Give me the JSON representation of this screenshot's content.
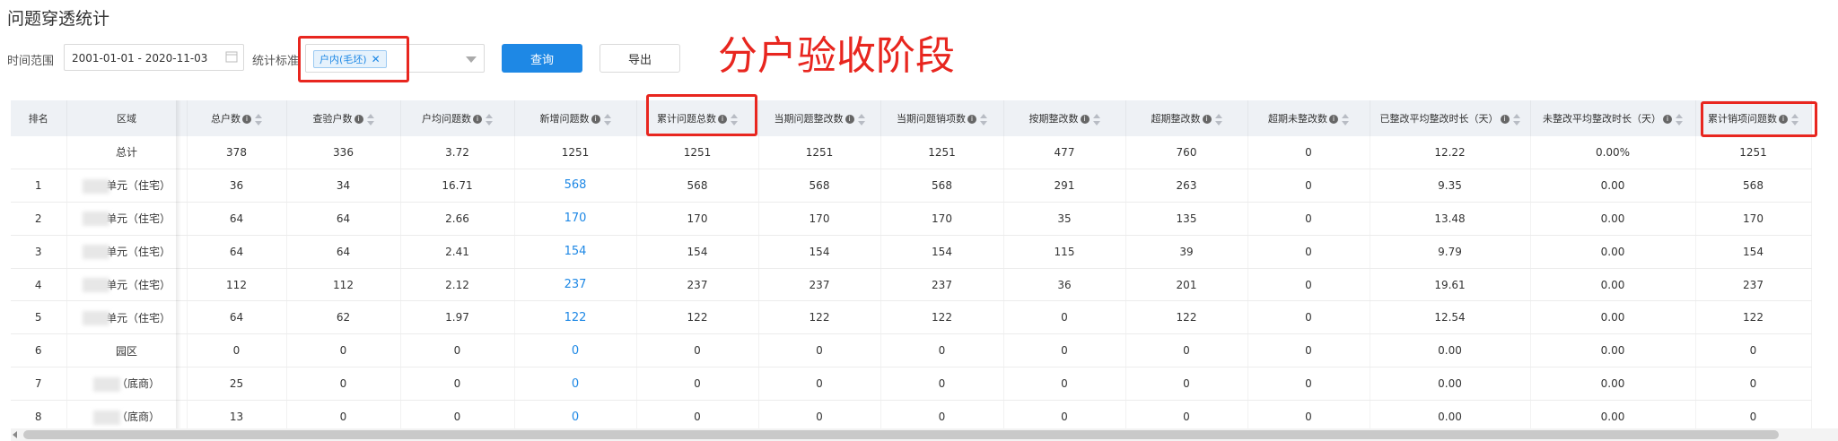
{
  "page_title": "问题穿透统计",
  "filters": {
    "time_label": "时间范围",
    "date_range": "2001-01-01 - 2020-11-03",
    "stat_label": "统计标准",
    "stat_tag": "户内(毛坯)",
    "query_label": "查询",
    "export_label": "导出"
  },
  "annotation": "分户验收阶段",
  "colors": {
    "accent": "#1e88e5",
    "annotation_red": "#e8261f",
    "header_bg": "#eef1f5"
  },
  "table": {
    "columns": [
      "排名",
      "区域",
      "总户数",
      "查验户数",
      "户均问题数",
      "新增问题数",
      "累计问题总数",
      "当期问题整改数",
      "当期问题销项数",
      "按期整改数",
      "超期整改数",
      "超期未整改数",
      "已整改平均整改时长（天）",
      "未整改平均整改时长（天）",
      "累计销项问题数"
    ],
    "rows": [
      {
        "rank": "",
        "area": "总计",
        "cells": [
          "378",
          "336",
          "3.72",
          "1251",
          "1251",
          "1251",
          "1251",
          "477",
          "760",
          "0",
          "12.22",
          "0.00%",
          "1251"
        ]
      },
      {
        "rank": "1",
        "area": "单元（住宅）",
        "cells": [
          "36",
          "34",
          "16.71",
          "568",
          "568",
          "568",
          "568",
          "291",
          "263",
          "0",
          "9.35",
          "0.00",
          "568"
        ]
      },
      {
        "rank": "2",
        "area": "单元（住宅）",
        "cells": [
          "64",
          "64",
          "2.66",
          "170",
          "170",
          "170",
          "170",
          "35",
          "135",
          "0",
          "13.48",
          "0.00",
          "170"
        ]
      },
      {
        "rank": "3",
        "area": "单元（住宅）",
        "cells": [
          "64",
          "64",
          "2.41",
          "154",
          "154",
          "154",
          "154",
          "115",
          "39",
          "0",
          "9.79",
          "0.00",
          "154"
        ]
      },
      {
        "rank": "4",
        "area": "单元（住宅）",
        "cells": [
          "112",
          "112",
          "2.12",
          "237",
          "237",
          "237",
          "237",
          "36",
          "201",
          "0",
          "19.61",
          "0.00",
          "237"
        ]
      },
      {
        "rank": "5",
        "area": "单元（住宅）",
        "cells": [
          "64",
          "62",
          "1.97",
          "122",
          "122",
          "122",
          "122",
          "0",
          "122",
          "0",
          "12.54",
          "0.00",
          "122"
        ]
      },
      {
        "rank": "6",
        "area": "园区",
        "cells": [
          "0",
          "0",
          "0",
          "0",
          "0",
          "0",
          "0",
          "0",
          "0",
          "0",
          "0.00",
          "0.00",
          "0"
        ]
      },
      {
        "rank": "7",
        "area": "（底商）",
        "cells": [
          "25",
          "0",
          "0",
          "0",
          "0",
          "0",
          "0",
          "0",
          "0",
          "0",
          "0.00",
          "0.00",
          "0"
        ]
      },
      {
        "rank": "8",
        "area": "（底商）",
        "cells": [
          "13",
          "0",
          "0",
          "0",
          "0",
          "0",
          "0",
          "0",
          "0",
          "0",
          "0.00",
          "0.00",
          "0"
        ]
      }
    ]
  }
}
